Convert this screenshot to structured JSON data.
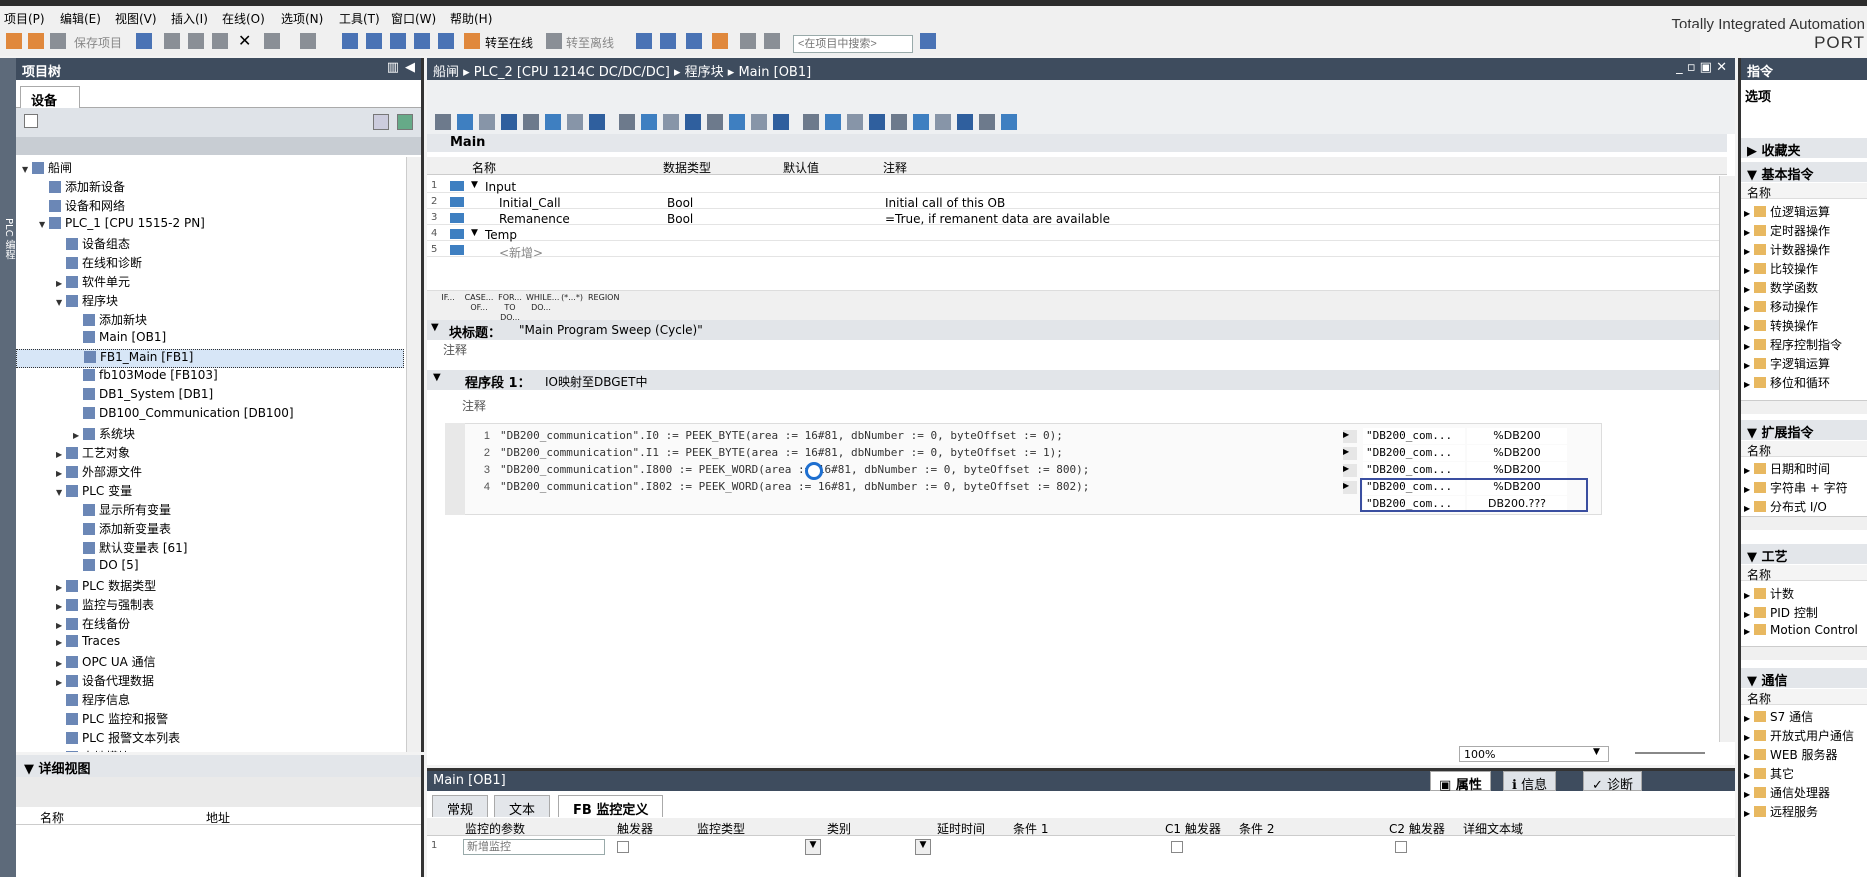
{
  "menu": [
    "项目(P)",
    "编辑(E)",
    "视图(V)",
    "插入(I)",
    "在线(O)",
    "选项(N)",
    "工具(T)",
    "窗口(W)",
    "帮助(H)"
  ],
  "brand": {
    "line1": "Totally Integrated Automation",
    "line2": "PORT"
  },
  "toolbar": {
    "save": "保存项目",
    "go_online": "转至在线",
    "go_offline": "转至离线",
    "search_placeholder": "<在项目中搜索>"
  },
  "side_label": "PLC 编程",
  "project_tree": {
    "title": "项目树",
    "tab": "设备",
    "items": [
      {
        "label": "船闸",
        "indent": 0,
        "arrow": "▼"
      },
      {
        "label": "添加新设备",
        "indent": 1,
        "arrow": ""
      },
      {
        "label": "设备和网络",
        "indent": 1,
        "arrow": ""
      },
      {
        "label": "PLC_1 [CPU 1515-2 PN]",
        "indent": 1,
        "arrow": "▼"
      },
      {
        "label": "设备组态",
        "indent": 2,
        "arrow": ""
      },
      {
        "label": "在线和诊断",
        "indent": 2,
        "arrow": ""
      },
      {
        "label": "软件单元",
        "indent": 2,
        "arrow": "▶"
      },
      {
        "label": "程序块",
        "indent": 2,
        "arrow": "▼"
      },
      {
        "label": "添加新块",
        "indent": 3,
        "arrow": ""
      },
      {
        "label": "Main [OB1]",
        "indent": 3,
        "arrow": ""
      },
      {
        "label": "FB1_Main [FB1]",
        "indent": 3,
        "arrow": "",
        "selected": true
      },
      {
        "label": "fb103Mode [FB103]",
        "indent": 3,
        "arrow": ""
      },
      {
        "label": "DB1_System [DB1]",
        "indent": 3,
        "arrow": ""
      },
      {
        "label": "DB100_Communication [DB100]",
        "indent": 3,
        "arrow": ""
      },
      {
        "label": "系统块",
        "indent": 3,
        "arrow": "▶"
      },
      {
        "label": "工艺对象",
        "indent": 2,
        "arrow": "▶"
      },
      {
        "label": "外部源文件",
        "indent": 2,
        "arrow": "▶"
      },
      {
        "label": "PLC 变量",
        "indent": 2,
        "arrow": "▼"
      },
      {
        "label": "显示所有变量",
        "indent": 3,
        "arrow": ""
      },
      {
        "label": "添加新变量表",
        "indent": 3,
        "arrow": ""
      },
      {
        "label": "默认变量表 [61]",
        "indent": 3,
        "arrow": ""
      },
      {
        "label": "DO [5]",
        "indent": 3,
        "arrow": ""
      },
      {
        "label": "PLC 数据类型",
        "indent": 2,
        "arrow": "▶"
      },
      {
        "label": "监控与强制表",
        "indent": 2,
        "arrow": "▶"
      },
      {
        "label": "在线备份",
        "indent": 2,
        "arrow": "▶"
      },
      {
        "label": "Traces",
        "indent": 2,
        "arrow": "▶"
      },
      {
        "label": "OPC UA 通信",
        "indent": 2,
        "arrow": "▶"
      },
      {
        "label": "设备代理数据",
        "indent": 2,
        "arrow": "▶"
      },
      {
        "label": "程序信息",
        "indent": 2,
        "arrow": ""
      },
      {
        "label": "PLC 监控和报警",
        "indent": 2,
        "arrow": ""
      },
      {
        "label": "PLC 报警文本列表",
        "indent": 2,
        "arrow": ""
      },
      {
        "label": "本地模块",
        "indent": 2,
        "arrow": "▶"
      }
    ]
  },
  "detail_view": {
    "title": "详细视图",
    "col_name": "名称",
    "col_addr": "地址"
  },
  "editor": {
    "breadcrumb": "船闸 ▸ PLC_2 [CPU 1214C DC/DC/DC] ▸ 程序块 ▸ Main [OB1]",
    "block": "Main",
    "cols": [
      "名称",
      "数据类型",
      "默认值",
      "注释"
    ],
    "rows": [
      {
        "n": "1",
        "arrow": "▼",
        "name": "Input",
        "type": "",
        "comment": ""
      },
      {
        "n": "2",
        "arrow": "",
        "name": "Initial_Call",
        "type": "Bool",
        "comment": "Initial call of this OB"
      },
      {
        "n": "3",
        "arrow": "",
        "name": "Remanence",
        "type": "Bool",
        "comment": "=True, if remanent data are available"
      },
      {
        "n": "4",
        "arrow": "▼",
        "name": "Temp",
        "type": "",
        "comment": ""
      },
      {
        "n": "5",
        "arrow": "",
        "name": "<新增>",
        "type": "",
        "comment": ""
      }
    ],
    "scl_buttons": [
      "IF...",
      "CASE... OF...",
      "FOR... TO DO...",
      "WHILE... DO...",
      "(*...*)",
      "REGION"
    ],
    "block_title_label": "块标题：",
    "block_title": "\"Main Program Sweep (Cycle)\"",
    "comment": "注释",
    "network_label": "程序段 1：",
    "network_title": "IO映射至DBGET中",
    "code": [
      {
        "n": "1",
        "t": "\"DB200_communication\".I0 := PEEK_BYTE(area := 16#81, dbNumber := 0, byteOffset := 0);"
      },
      {
        "n": "2",
        "t": "\"DB200_communication\".I1 := PEEK_BYTE(area := 16#81, dbNumber := 0, byteOffset := 1);"
      },
      {
        "n": "3",
        "t": "\"DB200_communication\".I800 := PEEK_WORD(area := 16#81, dbNumber := 0, byteOffset := 800);"
      },
      {
        "n": "4",
        "t": "\"DB200_communication\".I802 := PEEK_WORD(area := 16#81, dbNumber := 0, byteOffset := 802);"
      }
    ],
    "monitor": [
      {
        "v": "\"DB200_com...",
        "a": "%DB200"
      },
      {
        "v": "\"DB200_com...",
        "a": "%DB200"
      },
      {
        "v": "\"DB200_com...",
        "a": "%DB200"
      },
      {
        "v": "\"DB200_com...",
        "a": "%DB200"
      },
      {
        "v": "\"DB200_com...",
        "a": "DB200.???"
      }
    ],
    "zoom": "100%"
  },
  "bottom": {
    "title": "Main [OB1]",
    "inspector": [
      "属性",
      "信息",
      "诊断"
    ],
    "tabs": [
      "常规",
      "文本",
      "FB 监控定义"
    ],
    "cols": [
      "监控的参数",
      "触发器",
      "监控类型",
      "类别",
      "延时时间",
      "条件 1",
      "C1 触发器",
      "条件 2",
      "C2 触发器",
      "详细文本域"
    ],
    "row1_n": "1",
    "row1_placeholder": "新增监控"
  },
  "instructions": {
    "title": "指令",
    "options": "选项",
    "favorites": "收藏夹",
    "basic": "基本指令",
    "name": "名称",
    "basic_items": [
      "位逻辑运算",
      "定时器操作",
      "计数器操作",
      "比较操作",
      "数学函数",
      "移动操作",
      "转换操作",
      "程序控制指令",
      "字逻辑运算",
      "移位和循环"
    ],
    "extended": "扩展指令",
    "extended_items": [
      "日期和时间",
      "字符串 + 字符",
      "分布式 I/O"
    ],
    "tech": "工艺",
    "tech_items": [
      "计数",
      "PID 控制",
      "Motion Control"
    ],
    "comm": "通信",
    "comm_items": [
      "S7 通信",
      "开放式用户通信",
      "WEB 服务器",
      "其它",
      "通信处理器",
      "远程服务"
    ]
  }
}
